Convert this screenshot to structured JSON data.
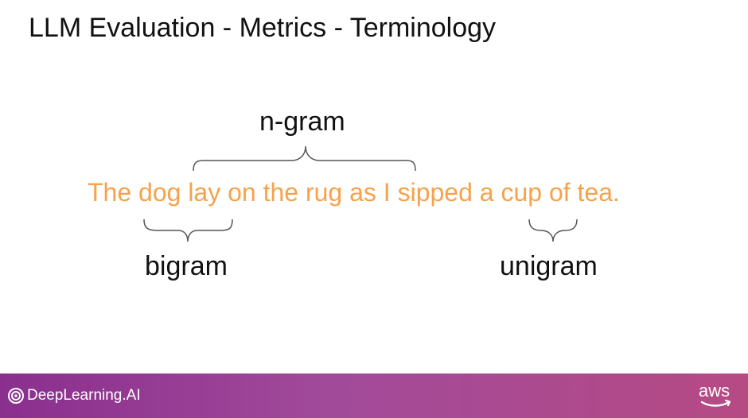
{
  "slide": {
    "title": "LLM Evaluation - Metrics - Terminology"
  },
  "diagram": {
    "sentence": "The dog lay on the rug as I sipped a cup of tea.",
    "labels": {
      "ngram": "n-gram",
      "bigram": "bigram",
      "unigram": "unigram"
    },
    "colors": {
      "sentence": "#f7a24a",
      "text": "#111111",
      "brace": "#555555"
    }
  },
  "footer": {
    "brand": "DeepLearning.AI",
    "partner": "aws",
    "brand_icon": "deeplearning-ai-logo-icon",
    "partner_icon": "aws-smile-icon"
  }
}
